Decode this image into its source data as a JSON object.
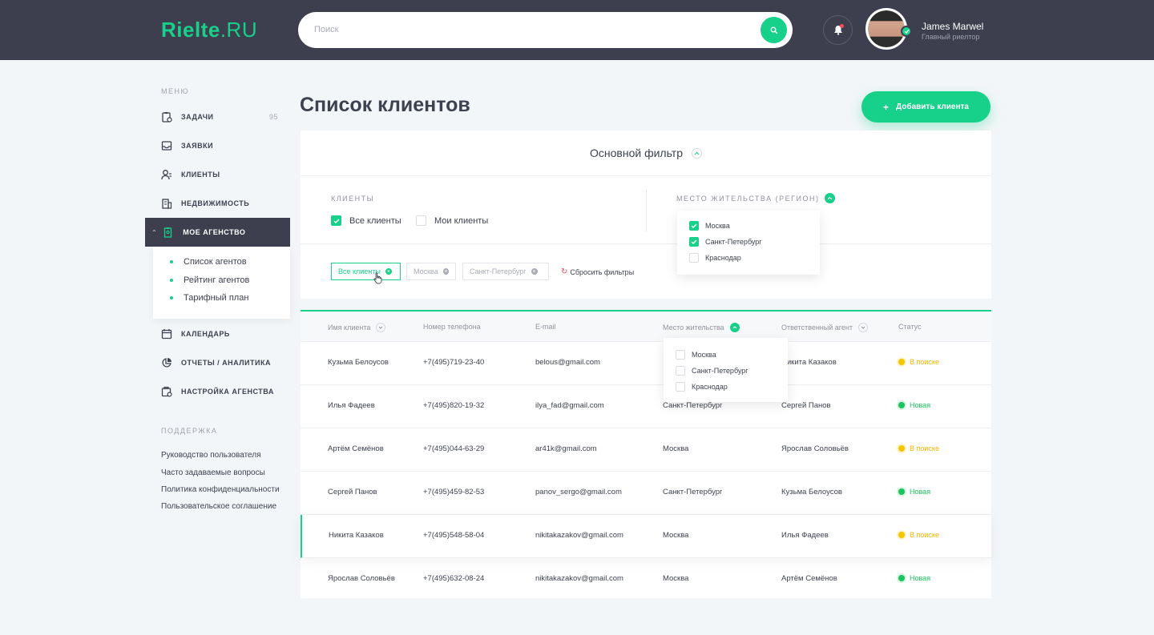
{
  "header": {
    "logo_main": "Rielte",
    "logo_suffix": ".RU",
    "search_placeholder": "Поиск",
    "user_name": "James Marwel",
    "user_role": "Главный риелтор"
  },
  "sidebar": {
    "menu_heading": "МЕНЮ",
    "items": [
      {
        "label": "ЗАДАЧИ",
        "count": "95",
        "icon": "tasks-icon"
      },
      {
        "label": "ЗАЯВКИ",
        "icon": "inbox-icon"
      },
      {
        "label": "КЛИЕНТЫ",
        "icon": "user-icon"
      },
      {
        "label": "НЕДВИЖИМОСТЬ",
        "icon": "building-icon"
      },
      {
        "label": "МОЕ АГЕНСТВО",
        "icon": "agency-icon",
        "active": true
      },
      {
        "label": "КАЛЕНДАРЬ",
        "icon": "calendar-icon"
      },
      {
        "label": "ОТЧЕТЫ / АНАЛИТИКА",
        "icon": "pie-chart-icon"
      },
      {
        "label": "НАСТРОЙКА АГЕНСТВА",
        "icon": "settings-icon"
      }
    ],
    "subitems": [
      "Список агентов",
      "Рейтинг агентов",
      "Тарифный план"
    ],
    "support_heading": "ПОДДЕРЖКА",
    "support_links": [
      "Руководство пользователя",
      "Часто задаваемые вопросы",
      "Политика конфиденциальности",
      "Пользовательское соглашение"
    ]
  },
  "main": {
    "title": "Список клиентов",
    "add_button": "Добавить клиента"
  },
  "filter": {
    "title": "Основной фильтр",
    "clients_label": "КЛИЕНТЫ",
    "all_clients": "Все клиенты",
    "my_clients": "Мои клиенты",
    "region_label": "МЕСТО ЖИТЕЛЬСТВА (РЕГИОН)",
    "region_options": [
      {
        "label": "Москва",
        "checked": true
      },
      {
        "label": "Санкт-Петербург",
        "checked": true
      },
      {
        "label": "Краснодар",
        "checked": false
      }
    ],
    "chips": [
      "Все клиенты",
      "Москва",
      "Санкт-Петербург"
    ],
    "reset": "Сбросить фильтры"
  },
  "table": {
    "columns": [
      "Имя клиента",
      "Номер телефона",
      "E-mail",
      "Место жительства",
      "Ответственный агент",
      "Статус"
    ],
    "location_options": [
      "Москва",
      "Санкт-Петербург",
      "Краснодар"
    ],
    "rows": [
      {
        "name": "Кузьма Белоусов",
        "phone": "+7(495)719-23-40",
        "email": "belous@gmail.com",
        "location": "",
        "agent": "Никита Казаков",
        "status": "В поиске",
        "status_type": "search"
      },
      {
        "name": "Илья Фадеев",
        "phone": "+7(495)820-19-32",
        "email": "ilya_fad@gmail.com",
        "location": "Санкт-Петербург",
        "agent": "Сергей Панов",
        "status": "Новая",
        "status_type": "new"
      },
      {
        "name": "Артём Семёнов",
        "phone": "+7(495)044-63-29",
        "email": "ar41k@gmail.com",
        "location": "Москва",
        "agent": "Ярослав Соловьёв",
        "status": "В поиске",
        "status_type": "search"
      },
      {
        "name": "Сергей Панов",
        "phone": "+7(495)459-82-53",
        "email": "panov_sergo@gmail.com",
        "location": "Санкт-Петербург",
        "agent": "Кузьма Белоусов",
        "status": "Новая",
        "status_type": "new"
      },
      {
        "name": "Никита Казаков",
        "phone": "+7(495)548-58-04",
        "email": "nikitakazakov@gmail.com",
        "location": "Москва",
        "agent": "Илья Фадеев",
        "status": "В поиске",
        "status_type": "search"
      },
      {
        "name": "Ярослав Соловьёв",
        "phone": "+7(495)632-08-24",
        "email": "nikitakazakov@gmail.com",
        "location": "Москва",
        "agent": "Артём Семёнов",
        "status": "Новая",
        "status_type": "new"
      }
    ]
  },
  "colors": {
    "accent": "#17d089",
    "header_bg": "#3d3f4f",
    "status_search": "#f7b500",
    "status_new": "#1bc45d"
  }
}
